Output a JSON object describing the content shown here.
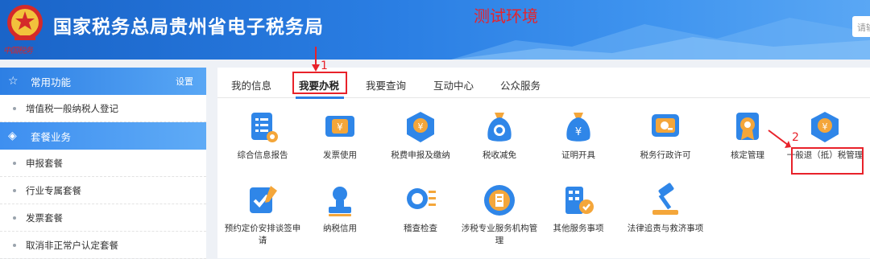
{
  "header": {
    "title": "国家税务总局贵州省电子税务局",
    "env_label": "测试环境",
    "motto": "中国税务",
    "search_placeholder": "请输"
  },
  "sidebar": {
    "common": {
      "label": "常用功能",
      "settings": "设置"
    },
    "common_items": [
      "增值税一般纳税人登记"
    ],
    "package": {
      "label": "套餐业务"
    },
    "package_items": [
      "申报套餐",
      "行业专属套餐",
      "发票套餐",
      "取消非正常户认定套餐"
    ]
  },
  "tabs": [
    {
      "label": "我的信息"
    },
    {
      "label": "我要办税"
    },
    {
      "label": "我要查询"
    },
    {
      "label": "互动中心"
    },
    {
      "label": "公众服务"
    }
  ],
  "services": [
    {
      "label": "综合信息报告",
      "icon": "report-icon"
    },
    {
      "label": "发票使用",
      "icon": "invoice-icon"
    },
    {
      "label": "税费申报及缴纳",
      "icon": "tax-declare-icon"
    },
    {
      "label": "税收减免",
      "icon": "tax-relief-icon"
    },
    {
      "label": "证明开具",
      "icon": "certificate-icon"
    },
    {
      "label": "税务行政许可",
      "icon": "license-icon"
    },
    {
      "label": "核定管理",
      "icon": "approval-icon"
    },
    {
      "label": "一般退（抵）税管理",
      "icon": "tax-refund-icon"
    },
    {
      "label": "预约定价安排谈签申请",
      "icon": "pricing-icon"
    },
    {
      "label": "纳税信用",
      "icon": "credit-icon"
    },
    {
      "label": "稽查检查",
      "icon": "inspection-icon"
    },
    {
      "label": "涉税专业服务机构管理",
      "icon": "agency-icon"
    },
    {
      "label": "其他服务事项",
      "icon": "other-services-icon"
    },
    {
      "label": "法律追责与救济事项",
      "icon": "legal-icon"
    }
  ],
  "annotations": [
    "1",
    "2"
  ],
  "colors": {
    "accent": "#2d7fe4",
    "annotation": "#e8222a",
    "icon_blue": "#2f86e8",
    "icon_orange": "#f4a63a"
  }
}
